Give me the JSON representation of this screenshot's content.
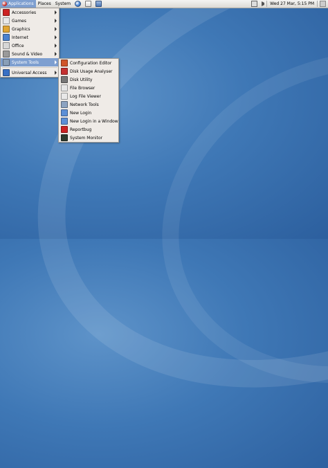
{
  "panel": {
    "menus": [
      "Applications",
      "Places",
      "System"
    ],
    "clock": "Wed 27 Mar,  5:15 PM"
  },
  "apps_menu": [
    {
      "label": "Accessories",
      "icon": "accessories-icon",
      "color": "#c22"
    },
    {
      "label": "Games",
      "icon": "games-icon",
      "color": "#e8e8e8"
    },
    {
      "label": "Graphics",
      "icon": "graphics-icon",
      "color": "#e1a533"
    },
    {
      "label": "Internet",
      "icon": "internet-icon",
      "color": "#4b82cf"
    },
    {
      "label": "Office",
      "icon": "office-icon",
      "color": "#d7d7d7"
    },
    {
      "label": "Sound & Video",
      "icon": "sound-video-icon",
      "color": "#9a9a9a"
    },
    {
      "label": "System Tools",
      "icon": "system-tools-icon",
      "color": "#8a9fb8"
    },
    {
      "label": "Universal Access",
      "icon": "universal-access-icon",
      "color": "#3970c4"
    }
  ],
  "system_tools_menu": [
    {
      "label": "Configuration Editor",
      "icon": "configuration-editor-icon",
      "color": "#d0552a"
    },
    {
      "label": "Disk Usage Analyser",
      "icon": "disk-usage-analyser-icon",
      "color": "#c43030"
    },
    {
      "label": "Disk Utility",
      "icon": "disk-utility-icon",
      "color": "#777777"
    },
    {
      "label": "File Browser",
      "icon": "file-browser-icon",
      "color": "#e6e6e6"
    },
    {
      "label": "Log File Viewer",
      "icon": "log-file-viewer-icon",
      "color": "#e8e8e8"
    },
    {
      "label": "Network Tools",
      "icon": "network-tools-icon",
      "color": "#8ca3c1"
    },
    {
      "label": "New Login",
      "icon": "new-login-icon",
      "color": "#5c8fd6"
    },
    {
      "label": "New Login in a Window",
      "icon": "new-login-window-icon",
      "color": "#5c8fd6"
    },
    {
      "label": "Reportbug",
      "icon": "reportbug-icon",
      "color": "#cc2222"
    },
    {
      "label": "System Monitor",
      "icon": "system-monitor-icon",
      "color": "#2e3b2e"
    }
  ]
}
